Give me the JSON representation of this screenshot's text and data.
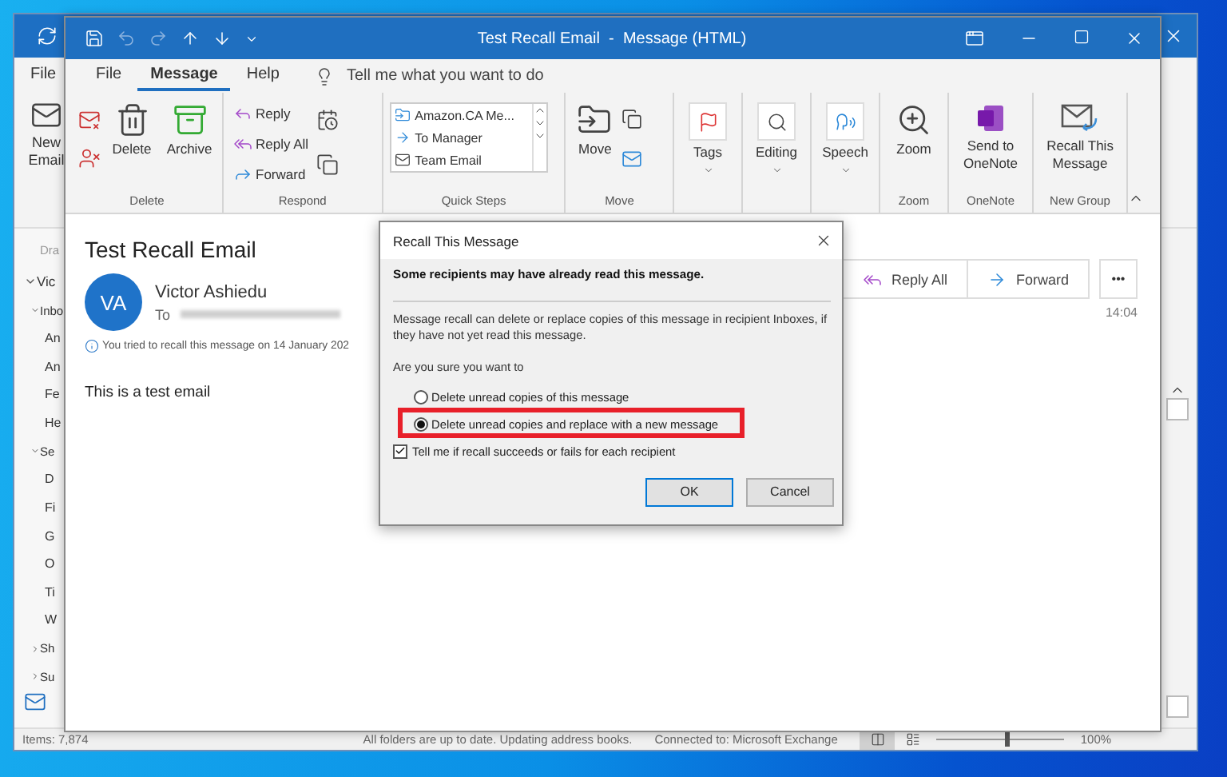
{
  "outlook_window": {
    "file_tab": "File",
    "new_email": "New Email",
    "folder_pane": {
      "heading": "Dra",
      "folders": [
        {
          "name": "Vic",
          "expanded": true,
          "children": [
            {
              "name": "Inbo",
              "expanded": true,
              "children": [
                {
                  "name": "An"
                },
                {
                  "name": "An"
                },
                {
                  "name": "Fe"
                },
                {
                  "name": "He"
                }
              ]
            },
            {
              "name": "Se",
              "expanded": true,
              "children": [
                {
                  "name": "D"
                },
                {
                  "name": "Fi"
                },
                {
                  "name": "G"
                },
                {
                  "name": "O"
                },
                {
                  "name": "Ti"
                },
                {
                  "name": "W"
                }
              ]
            },
            {
              "name": "Sh",
              "expanded": false
            },
            {
              "name": "Su",
              "expanded": false
            }
          ]
        }
      ]
    },
    "status_bar": {
      "items": "Items: 7,874",
      "sync": "All folders are up to date.  Updating address books.",
      "connection": "Connected to: Microsoft Exchange",
      "zoom_slider": {
        "level": 0.55
      },
      "zoom": "100%"
    }
  },
  "message_window": {
    "title": "Test Recall Email  -  Message (HTML)",
    "tabs": [
      {
        "label": "File",
        "selected": false
      },
      {
        "label": "Message",
        "selected": true
      },
      {
        "label": "Help",
        "selected": false
      }
    ],
    "tell_me": "Tell me what you want to do",
    "ribbon": {
      "delete_group": {
        "label": "Delete",
        "buttons": [
          "Delete",
          "Archive"
        ]
      },
      "respond_group": {
        "label": "Respond",
        "actions": [
          "Reply",
          "Reply All",
          "Forward"
        ]
      },
      "quick_steps_group": {
        "label": "Quick Steps",
        "steps": [
          "Amazon.CA Me...",
          "To Manager",
          "Team Email"
        ]
      },
      "move_group": {
        "label": "Move",
        "button": "Move"
      },
      "tags": "Tags",
      "editing": "Editing",
      "speech": "Speech",
      "zoom_group": {
        "label": "Zoom",
        "button": "Zoom"
      },
      "onenote_group": {
        "label": "OneNote",
        "button": "Send to OneNote"
      },
      "new_group": {
        "label": "New Group",
        "button": "Recall This Message"
      }
    },
    "message": {
      "subject": "Test Recall Email",
      "avatar": "VA",
      "sender": "Victor Ashiedu",
      "to_label": "To",
      "info": "You tried to recall this message on 14 January 202",
      "body": "This is a test email",
      "actions": [
        "Reply All",
        "Forward"
      ],
      "more": "•••",
      "time": "14:04"
    }
  },
  "recall_dialog": {
    "title": "Recall This Message",
    "warning": "Some recipients may have already read this message.",
    "explanation": "Message recall can delete or replace copies of this message in recipient Inboxes, if they have not yet read this message.",
    "question": "Are you sure you want to",
    "options": [
      {
        "label": "Delete unread copies of this message",
        "selected": false,
        "highlighted": false
      },
      {
        "label": "Delete unread copies and replace with a new message",
        "selected": true,
        "highlighted": true
      }
    ],
    "notify": {
      "label": "Tell me if recall succeeds or fails for each recipient",
      "checked": true
    },
    "buttons": [
      "OK",
      "Cancel"
    ]
  }
}
